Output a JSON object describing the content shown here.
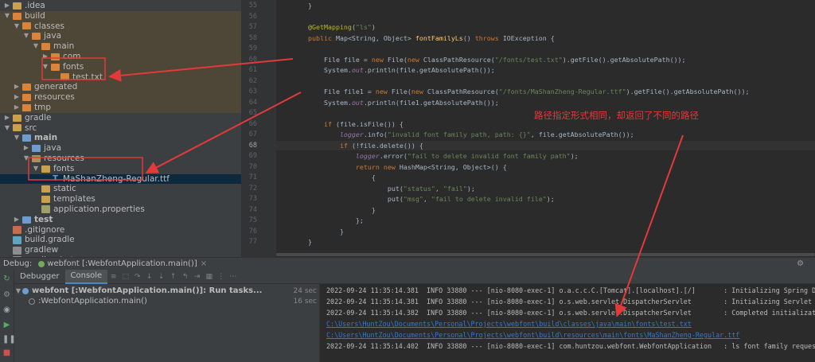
{
  "tree": [
    {
      "label": ".idea",
      "depth": 0,
      "chev": "right",
      "icon": "folder",
      "hl": false
    },
    {
      "label": "build",
      "depth": 0,
      "chev": "down",
      "icon": "folder-orange",
      "hl": true
    },
    {
      "label": "classes",
      "depth": 1,
      "chev": "down",
      "icon": "folder-orange",
      "hl": true
    },
    {
      "label": "java",
      "depth": 2,
      "chev": "down",
      "icon": "folder-orange",
      "hl": true
    },
    {
      "label": "main",
      "depth": 3,
      "chev": "down",
      "icon": "folder-orange",
      "hl": true
    },
    {
      "label": "com",
      "depth": 4,
      "chev": "right",
      "icon": "folder-orange",
      "hl": true
    },
    {
      "label": "fonts",
      "depth": 4,
      "chev": "down",
      "icon": "folder-orange",
      "hl": true
    },
    {
      "label": "test.txt",
      "depth": 5,
      "chev": "",
      "icon": "folder-orange",
      "hl": true
    },
    {
      "label": "generated",
      "depth": 1,
      "chev": "right",
      "icon": "folder-orange",
      "hl": true
    },
    {
      "label": "resources",
      "depth": 1,
      "chev": "right",
      "icon": "folder-orange",
      "hl": true
    },
    {
      "label": "tmp",
      "depth": 1,
      "chev": "right",
      "icon": "folder-orange",
      "hl": true
    },
    {
      "label": "gradle",
      "depth": 0,
      "chev": "right",
      "icon": "folder",
      "hl": false
    },
    {
      "label": "src",
      "depth": 0,
      "chev": "down",
      "icon": "folder",
      "hl": false
    },
    {
      "label": "main",
      "depth": 1,
      "chev": "down",
      "icon": "folder-blue",
      "hl": false,
      "bold": true
    },
    {
      "label": "java",
      "depth": 2,
      "chev": "right",
      "icon": "folder-blue",
      "hl": false
    },
    {
      "label": "resources",
      "depth": 2,
      "chev": "down",
      "icon": "folder-res",
      "hl": false
    },
    {
      "label": "fonts",
      "depth": 3,
      "chev": "down",
      "icon": "folder",
      "hl": false
    },
    {
      "label": "MaShanZheng-Regular.ttf",
      "depth": 4,
      "chev": "",
      "icon": "font",
      "hl": false,
      "sel": true
    },
    {
      "label": "static",
      "depth": 3,
      "chev": "",
      "icon": "folder",
      "hl": false
    },
    {
      "label": "templates",
      "depth": 3,
      "chev": "",
      "icon": "folder",
      "hl": false
    },
    {
      "label": "application.properties",
      "depth": 3,
      "chev": "",
      "icon": "file-prop",
      "hl": false
    },
    {
      "label": "test",
      "depth": 1,
      "chev": "right",
      "icon": "folder-blue",
      "hl": false,
      "bold": true
    },
    {
      "label": ".gitignore",
      "depth": 0,
      "chev": "",
      "icon": "file-git",
      "hl": false
    },
    {
      "label": "build.gradle",
      "depth": 0,
      "chev": "",
      "icon": "file-gradle",
      "hl": false
    },
    {
      "label": "gradlew",
      "depth": 0,
      "chev": "",
      "icon": "file-txt",
      "hl": false
    },
    {
      "label": "gradlew.bat",
      "depth": 0,
      "chev": "",
      "icon": "file-txt",
      "hl": false
    }
  ],
  "editor": {
    "line_numbers": [
      "55",
      "56",
      "57",
      "58",
      "59",
      "60",
      "61",
      "62",
      "63",
      "64",
      "65",
      "66",
      "67",
      "68",
      "69",
      "70",
      "71",
      "72",
      "73",
      "74",
      "75",
      "76",
      "77"
    ],
    "current_line": "68",
    "lines": [
      [
        {
          "t": "    }",
          "c": ""
        }
      ],
      [
        {
          "t": "",
          "c": ""
        }
      ],
      [
        {
          "t": "    @GetMapping",
          "c": "an"
        },
        {
          "t": "(",
          "c": ""
        },
        {
          "t": "\"ls\"",
          "c": "st"
        },
        {
          "t": ")",
          "c": ""
        }
      ],
      [
        {
          "t": "    public ",
          "c": "kw"
        },
        {
          "t": "Map<String, Object> ",
          "c": ""
        },
        {
          "t": "fontFamilyLs",
          "c": "fn"
        },
        {
          "t": "() ",
          "c": ""
        },
        {
          "t": "throws ",
          "c": "kw"
        },
        {
          "t": "IOException {",
          "c": ""
        }
      ],
      [
        {
          "t": "",
          "c": ""
        }
      ],
      [
        {
          "t": "        File file = ",
          "c": ""
        },
        {
          "t": "new ",
          "c": "kw"
        },
        {
          "t": "File(",
          "c": ""
        },
        {
          "t": "new ",
          "c": "kw"
        },
        {
          "t": "ClassPathResource(",
          "c": ""
        },
        {
          "t": "\"/fonts/test.txt\"",
          "c": "st"
        },
        {
          "t": ").getFile().getAbsolutePath());",
          "c": ""
        }
      ],
      [
        {
          "t": "        System.",
          "c": ""
        },
        {
          "t": "out",
          "c": "it"
        },
        {
          "t": ".println(file.getAbsolutePath());",
          "c": ""
        }
      ],
      [
        {
          "t": "",
          "c": ""
        }
      ],
      [
        {
          "t": "        File file1 = ",
          "c": ""
        },
        {
          "t": "new ",
          "c": "kw"
        },
        {
          "t": "File(",
          "c": ""
        },
        {
          "t": "new ",
          "c": "kw"
        },
        {
          "t": "ClassPathResource(",
          "c": ""
        },
        {
          "t": "\"/fonts/MaShanZheng-Regular.ttf\"",
          "c": "st"
        },
        {
          "t": ").getFile().getAbsolutePath());",
          "c": ""
        }
      ],
      [
        {
          "t": "        System.",
          "c": ""
        },
        {
          "t": "out",
          "c": "it"
        },
        {
          "t": ".println(file1.getAbsolutePath());",
          "c": ""
        }
      ],
      [
        {
          "t": "",
          "c": ""
        }
      ],
      [
        {
          "t": "        if ",
          "c": "kw"
        },
        {
          "t": "(file.isFile()) {",
          "c": ""
        }
      ],
      [
        {
          "t": "            logger",
          "c": "it"
        },
        {
          "t": ".info(",
          "c": ""
        },
        {
          "t": "\"invalid font family path, path: {}\"",
          "c": "st"
        },
        {
          "t": ", file.getAbsolutePath());",
          "c": ""
        }
      ],
      [
        {
          "t": "            if ",
          "c": "kw"
        },
        {
          "t": "(!file.delete()) {",
          "c": ""
        }
      ],
      [
        {
          "t": "                logger",
          "c": "it"
        },
        {
          "t": ".error(",
          "c": ""
        },
        {
          "t": "\"fail to delete invalid font family path\"",
          "c": "st"
        },
        {
          "t": ");",
          "c": ""
        }
      ],
      [
        {
          "t": "                return new ",
          "c": "kw"
        },
        {
          "t": "HashMap<String, Object>() {",
          "c": ""
        }
      ],
      [
        {
          "t": "                    {",
          "c": ""
        }
      ],
      [
        {
          "t": "                        put(",
          "c": ""
        },
        {
          "t": "\"status\"",
          "c": "st"
        },
        {
          "t": ", ",
          "c": ""
        },
        {
          "t": "\"fail\"",
          "c": "st"
        },
        {
          "t": ");",
          "c": ""
        }
      ],
      [
        {
          "t": "                        put(",
          "c": ""
        },
        {
          "t": "\"msg\"",
          "c": "st"
        },
        {
          "t": ", ",
          "c": ""
        },
        {
          "t": "\"fail to delete invalid file\"",
          "c": "st"
        },
        {
          "t": ");",
          "c": ""
        }
      ],
      [
        {
          "t": "                    }",
          "c": ""
        }
      ],
      [
        {
          "t": "                };",
          "c": ""
        }
      ],
      [
        {
          "t": "            }",
          "c": ""
        }
      ],
      [
        {
          "t": "    }",
          "c": ""
        }
      ]
    ],
    "annotation_cn": "路径指定形式相同，却返回了不同的路径"
  },
  "debug": {
    "label": "Debug:",
    "tab_label": "webfont [:WebfontApplication.main()]",
    "close": "×",
    "tabs": [
      "Debugger",
      "Console"
    ],
    "active_tab": "Console",
    "frames": [
      {
        "label": "webfont [:WebfontApplication.main()]: Run tasks...",
        "time": "24 sec",
        "bold": true
      },
      {
        "label": ":WebfontApplication.main()",
        "time": "16 sec",
        "bold": false
      }
    ]
  },
  "console": {
    "lines": [
      {
        "text": "2022-09-24 11:35:14.381  INFO 33880 --- [nio-8080-exec-1] o.a.c.c.C.[Tomcat].[localhost].[/]       : Initializing Spring D",
        "link": false
      },
      {
        "text": "2022-09-24 11:35:14.381  INFO 33880 --- [nio-8080-exec-1] o.s.web.servlet.DispatcherServlet        : Initializing Servlet",
        "link": false
      },
      {
        "text": "2022-09-24 11:35:14.382  INFO 33880 --- [nio-8080-exec-1] o.s.web.servlet.DispatcherServlet        : Completed initializat",
        "link": false
      },
      {
        "text": "C:\\Users\\HuntZou\\Documents\\Personal\\Projects\\webfont\\build\\classes\\java\\main\\fonts\\test.txt",
        "link": true
      },
      {
        "text": "C:\\Users\\HuntZou\\Documents\\Personal\\Projects\\webfont\\build\\resources\\main\\fonts\\MaShanZheng-Regular.ttf",
        "link": true
      },
      {
        "text": "2022-09-24 11:35:14.402  INFO 33880 --- [nio-8080-exec-1] com.huntzou.webfont.WebfontApplication   : ls font family reques",
        "link": false
      }
    ]
  },
  "colors": {
    "annotation": "#e23a3a",
    "highlight_build": "#4e4636",
    "link": "#287bde"
  }
}
